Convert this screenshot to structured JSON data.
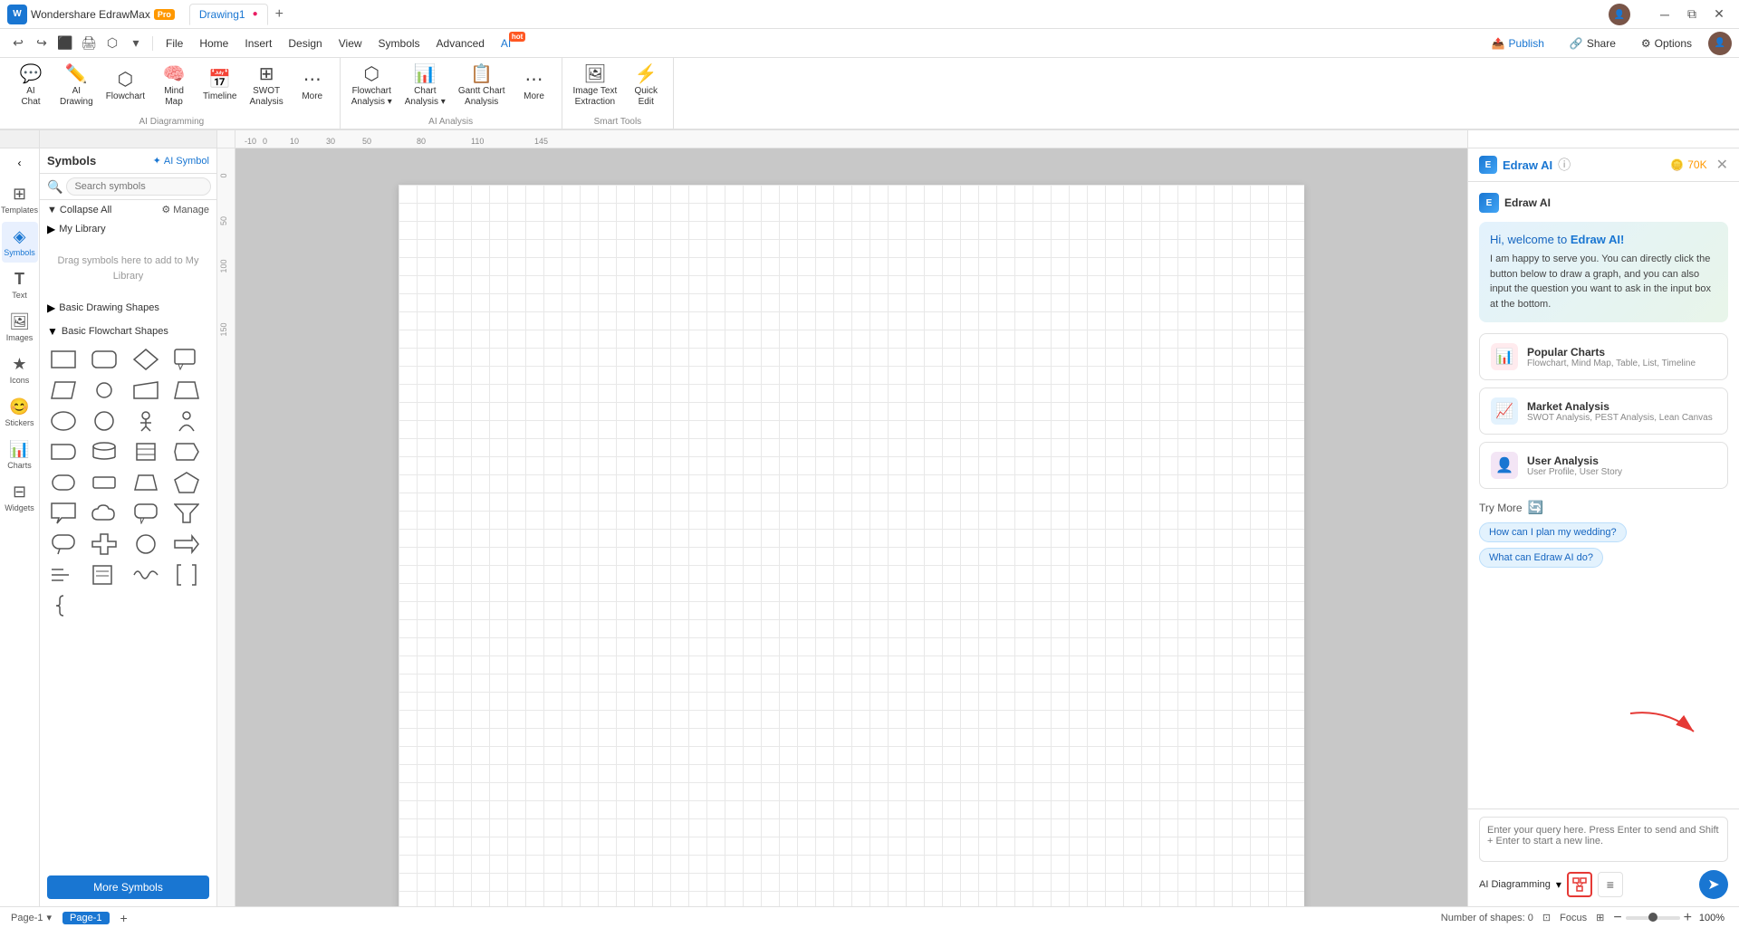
{
  "app": {
    "name": "Wondershare EdrawMax",
    "version": "Pro",
    "logo_letter": "W"
  },
  "tabs": [
    {
      "id": "tab1",
      "label": "Drawing1",
      "active": true,
      "dirty": true
    }
  ],
  "titlebar": {
    "new_tab_label": "+",
    "win_minimize": "─",
    "win_restore": "⧉",
    "win_close": "✕"
  },
  "menubar": {
    "items": [
      "File",
      "Home",
      "Insert",
      "Design",
      "View",
      "Symbols",
      "Advanced"
    ],
    "ai_label": "AI",
    "ai_badge": "hot",
    "right": {
      "publish": "Publish",
      "share": "Share",
      "options": "Options"
    }
  },
  "quick_access": {
    "buttons": [
      "↩",
      "↪",
      "⬛",
      "🖨",
      "⬡",
      "▾"
    ]
  },
  "ribbon": {
    "ai_diagramming": {
      "label": "AI Diagramming",
      "buttons": [
        {
          "id": "ai-chat",
          "icon": "💬",
          "label": "AI\nChat"
        },
        {
          "id": "ai-drawing",
          "icon": "✏️",
          "label": "AI\nDrawing"
        },
        {
          "id": "flowchart",
          "icon": "⬡",
          "label": "Flowchart"
        },
        {
          "id": "mind-map",
          "icon": "🧠",
          "label": "Mind\nMap"
        },
        {
          "id": "timeline",
          "icon": "📅",
          "label": "Timeline"
        },
        {
          "id": "swot",
          "icon": "⊞",
          "label": "SWOT\nAnalysis"
        },
        {
          "id": "more1",
          "icon": "⋯",
          "label": "More"
        }
      ]
    },
    "ai_analysis": {
      "label": "AI Analysis",
      "buttons": [
        {
          "id": "flowchart-analysis",
          "icon": "⬡",
          "label": "Flowchart\nAnalysis",
          "has_dropdown": true
        },
        {
          "id": "chart-analysis",
          "icon": "📊",
          "label": "Chart\nAnalysis",
          "has_dropdown": true
        },
        {
          "id": "gantt-analysis",
          "icon": "📋",
          "label": "Gantt Chart\nAnalysis"
        },
        {
          "id": "more2",
          "icon": "⋯",
          "label": "More"
        }
      ]
    },
    "smart_tools": {
      "label": "Smart Tools",
      "buttons": [
        {
          "id": "image-text",
          "icon": "🖼",
          "label": "Image Text\nExtraction"
        },
        {
          "id": "quick-edit",
          "icon": "⚡",
          "label": "Quick\nEdit"
        }
      ]
    }
  },
  "left_nav": {
    "items": [
      {
        "id": "templates",
        "icon": "⊞",
        "label": "Templates"
      },
      {
        "id": "symbols",
        "icon": "◈",
        "label": "Symbols",
        "active": true
      },
      {
        "id": "text",
        "icon": "T",
        "label": "Text"
      },
      {
        "id": "images",
        "icon": "🖼",
        "label": "Images"
      },
      {
        "id": "icons",
        "icon": "★",
        "label": "Icons"
      },
      {
        "id": "stickers",
        "icon": "😊",
        "label": "Stickers"
      },
      {
        "id": "charts",
        "icon": "📊",
        "label": "Charts"
      },
      {
        "id": "widgets",
        "icon": "⊟",
        "label": "Widgets"
      }
    ]
  },
  "symbols_panel": {
    "title": "Symbols",
    "ai_symbol_label": "AI Symbol",
    "search_placeholder": "Search symbols",
    "collapse_all": "Collapse All",
    "manage": "Manage",
    "my_library": {
      "label": "My Library",
      "empty_text": "Drag symbols here\nto add to My Library"
    },
    "sections": [
      {
        "id": "basic-drawing",
        "label": "Basic Drawing Shapes",
        "expanded": true
      },
      {
        "id": "basic-flowchart",
        "label": "Basic Flowchart Shapes",
        "expanded": true
      }
    ],
    "more_symbols_btn": "More Symbols"
  },
  "canvas": {
    "grid": true
  },
  "edraw_ai": {
    "title": "Edraw AI",
    "help_icon": "?",
    "token_count": "70K",
    "ai_name": "Edraw AI",
    "greeting": {
      "hi": "Hi, welcome to Edraw AI!",
      "hi_brand": "Edraw AI",
      "desc": "I am happy to serve you. You can directly click the button below to draw a graph, and you can also input the question you want to ask in the input box at the bottom."
    },
    "suggestions": [
      {
        "id": "popular-charts",
        "icon": "📊",
        "icon_color": "red",
        "title": "Popular Charts",
        "subtitle": "Flowchart, Mind Map, Table, List, Timeline"
      },
      {
        "id": "market-analysis",
        "icon": "📈",
        "icon_color": "blue",
        "title": "Market Analysis",
        "subtitle": "SWOT Analysis, PEST Analysis, Lean Canvas"
      },
      {
        "id": "user-analysis",
        "icon": "👤",
        "icon_color": "purple",
        "title": "User Analysis",
        "subtitle": "User Profile, User Story"
      }
    ],
    "try_more": "Try More",
    "chips": [
      "How can I plan my wedding?",
      "What can Edraw AI do?"
    ],
    "input_placeholder": "Enter your query here. Press Enter to send and Shift + Enter to start a new line.",
    "mode_label": "AI Diagramming",
    "send_icon": "➤"
  },
  "statusbar": {
    "page_label": "Page-1",
    "page_tab": "Page-1",
    "add_page": "+",
    "shapes_label": "Number of shapes:",
    "shapes_count": "0",
    "focus": "Focus",
    "zoom": "100%",
    "zoom_minus": "−",
    "zoom_plus": "+"
  },
  "colors": {
    "accent": "#1976d2",
    "brand_red": "#e53935",
    "ai_hot": "#ff5722"
  }
}
